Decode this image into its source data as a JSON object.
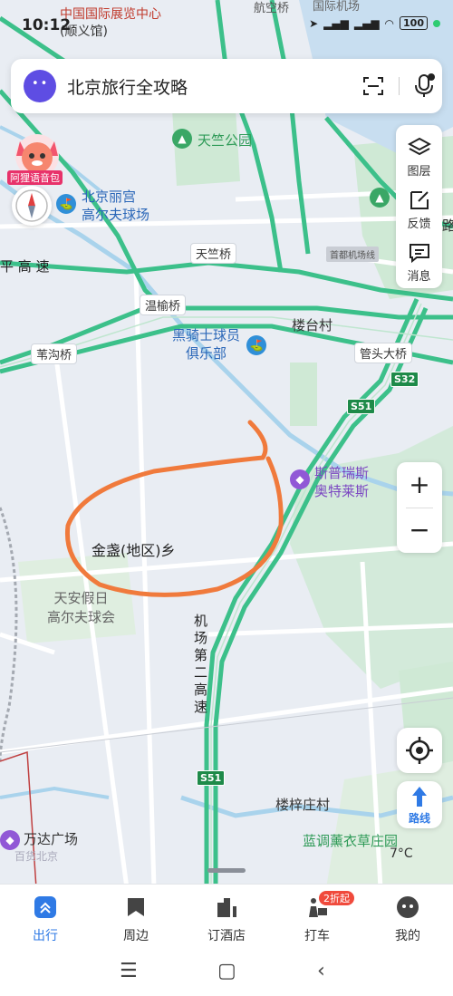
{
  "status": {
    "time": "10:12",
    "battery": "100",
    "top_labels": [
      "中国国际展览中心",
      "(顺义馆)",
      "航空桥",
      "国际机场"
    ]
  },
  "search": {
    "placeholder": "北京旅行全攻略"
  },
  "tools": {
    "layers": "图层",
    "feedback": "反馈",
    "messages": "消息"
  },
  "mascot": {
    "label": "阿狸语音包"
  },
  "map_labels": {
    "park": "天竺公园",
    "golf1_line1": "北京丽宫",
    "golf1_line2": "高尔夫球场",
    "tianzhu_bridge": "天竺桥",
    "airport_line": "首都机场线",
    "highway_left": "平 高 速",
    "wenyu_bridge": "温榆桥",
    "club_line1": "黑骑士球员",
    "club_line2": "俱乐部",
    "loutai": "楼台村",
    "weigou": "苇沟桥",
    "guantou": "管头大桥",
    "s32": "S32",
    "s51_top": "S51",
    "outlet_line1": "斯普瑞斯",
    "outlet_line2": "奥特莱斯",
    "jinzhan": "金盏(地区)乡",
    "golf2_line1": "天安假日",
    "golf2_line2": "高尔夫球会",
    "airport_hwy": "机场第二高速",
    "s51_bottom": "S51",
    "louzizhuang": "楼梓庄村",
    "wanda": "万达广场",
    "wanda_sub": "百货北京",
    "lavender": "蓝调薰衣草庄园",
    "edge_right": "路"
  },
  "weather": "7°C",
  "route": {
    "label": "路线"
  },
  "bottom_nav": {
    "items": [
      "出行",
      "周边",
      "订酒店",
      "打车",
      "我的"
    ],
    "badge": "2折起"
  },
  "colors": {
    "highway": "#3cc08a",
    "annotation": "#f07a3c",
    "accent": "#2f7ae5",
    "park": "#cfe9d5",
    "water": "#a9d3ec"
  }
}
